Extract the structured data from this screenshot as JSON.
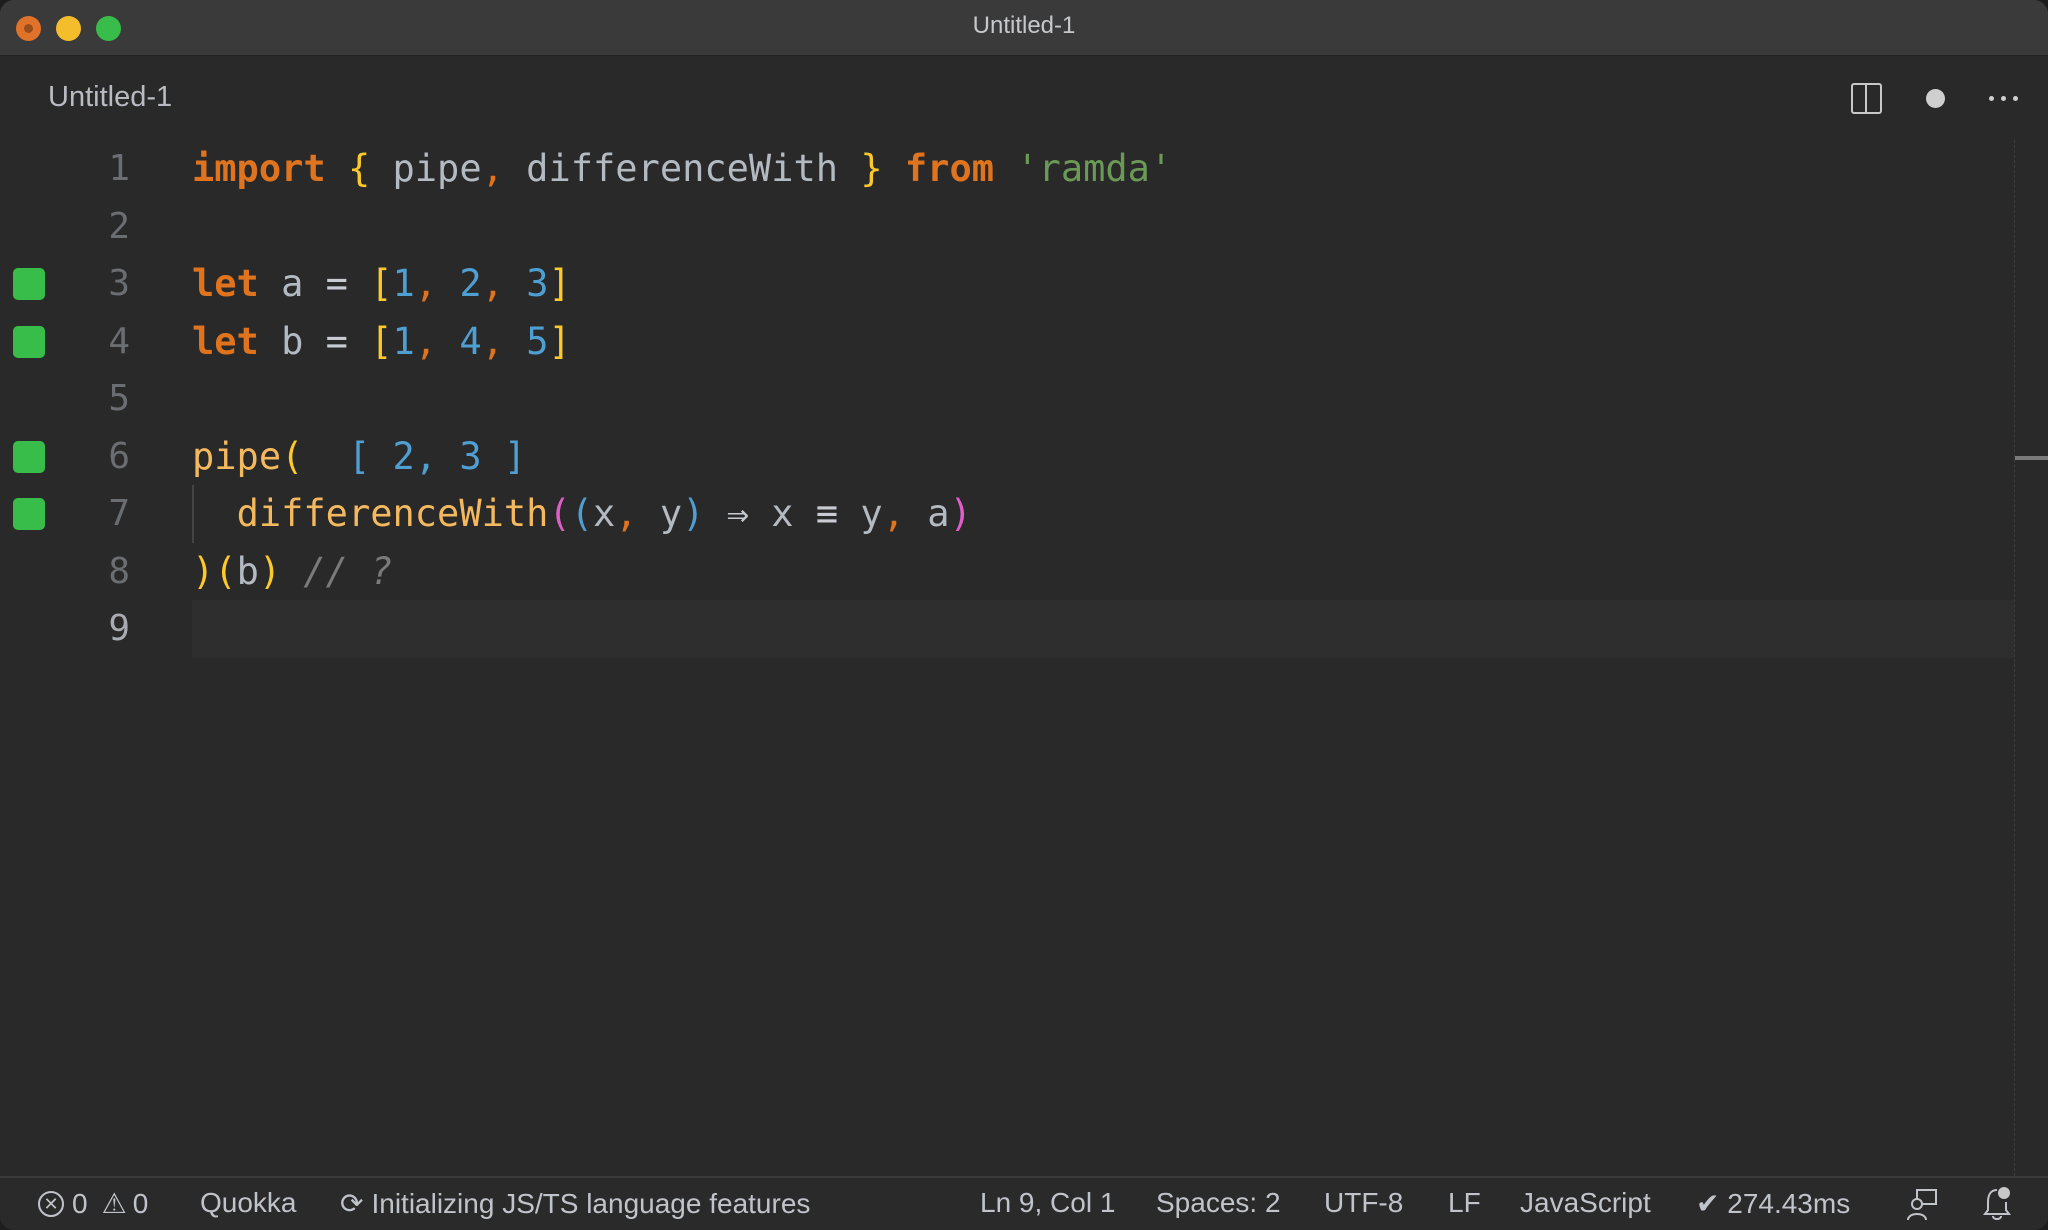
{
  "window": {
    "title": "Untitled-1",
    "controls": [
      "close",
      "minimize",
      "maximize"
    ]
  },
  "tab": {
    "label": "Untitled-1",
    "actions": [
      {
        "name": "split-editor-icon"
      },
      {
        "name": "unsaved-dot-icon"
      },
      {
        "name": "more-actions-icon"
      }
    ]
  },
  "editor": {
    "language": "JavaScript",
    "current_line": 9,
    "lines": [
      {
        "n": "1",
        "coverage": false
      },
      {
        "n": "2",
        "coverage": false
      },
      {
        "n": "3",
        "coverage": true
      },
      {
        "n": "4",
        "coverage": true
      },
      {
        "n": "5",
        "coverage": false
      },
      {
        "n": "6",
        "coverage": true
      },
      {
        "n": "7",
        "coverage": true
      },
      {
        "n": "8",
        "coverage": false
      },
      {
        "n": "9",
        "coverage": false
      }
    ],
    "tokens": {
      "l1": {
        "import": "import",
        "ob": "{",
        "pipe": "pipe",
        "c1": ",",
        "dw": "differenceWith",
        "cb": "}",
        "from": "from",
        "str": "'ramda'"
      },
      "l3": {
        "let": "let",
        "name": "a",
        "eq": "=",
        "ob": "[",
        "v1": "1",
        "c1": ",",
        "v2": "2",
        "c2": ",",
        "v3": "3",
        "cb": "]"
      },
      "l4": {
        "let": "let",
        "name": "b",
        "eq": "=",
        "ob": "[",
        "v1": "1",
        "c1": ",",
        "v2": "4",
        "c2": ",",
        "v3": "5",
        "cb": "]"
      },
      "l6": {
        "fn": "pipe",
        "op": "(",
        "inline_result": "[ 2, 3 ]"
      },
      "l7": {
        "fn": "differenceWith",
        "op1": "(",
        "op2": "(",
        "x": "x",
        "c1": ",",
        "y": "y",
        "cp2": ")",
        "arrow": "⇒",
        "x2": "x",
        "eqq": "≡",
        "y2": "y",
        "c2": ",",
        "a": "a",
        "cp1": ")"
      },
      "l8": {
        "cp": ")",
        "op": "(",
        "b": "b",
        "cp2": ")",
        "cmt": "// ?"
      }
    }
  },
  "statusbar": {
    "errors": "0",
    "warnings": "0",
    "quokka": "Quokka",
    "progress": "Initializing JS/TS language features",
    "cursor": "Ln 9, Col 1",
    "indent": "Spaces: 2",
    "encoding": "UTF-8",
    "eol": "LF",
    "language": "JavaScript",
    "timing": "✔ 274.43ms"
  },
  "colors": {
    "coverage": "#38bd4a",
    "keyword": "#e0741e",
    "bracket_yellow": "#fcc82a",
    "bracket_blue": "#4f9fd2",
    "bracket_magenta": "#e05ec9",
    "string": "#6a9a55",
    "function": "#f4b95e"
  }
}
